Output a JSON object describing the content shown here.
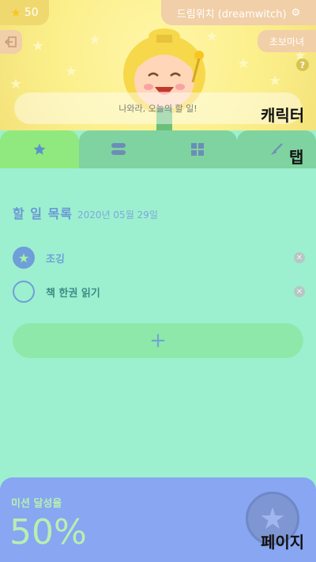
{
  "header": {
    "coins": "50",
    "user": "드림위치 (dreamwitch)",
    "rank": "초보마녀",
    "speech": "나와라, 오늘의 할 일!",
    "help": "?"
  },
  "annotations": {
    "character": "캐릭터",
    "tab": "탭",
    "page": "페이지"
  },
  "tabs": [
    {
      "icon": "star-icon",
      "active": true
    },
    {
      "icon": "toggle-icon",
      "active": false
    },
    {
      "icon": "grid-icon",
      "active": false
    },
    {
      "icon": "broom-icon",
      "active": false
    }
  ],
  "todo": {
    "title": "할 일 목록",
    "date": "2020년 05월 29일",
    "items": [
      {
        "label": "조깅",
        "done": true
      },
      {
        "label": "책 한권 읽기",
        "done": false
      }
    ],
    "add": "+"
  },
  "mission": {
    "label": "미션 달성율",
    "value": "50%"
  },
  "colors": {
    "page_bg": "#9cf0cf",
    "accent_blue": "#6f9ed9",
    "mission_bg": "#88a6f2",
    "char_bg": "#fbef8a"
  }
}
